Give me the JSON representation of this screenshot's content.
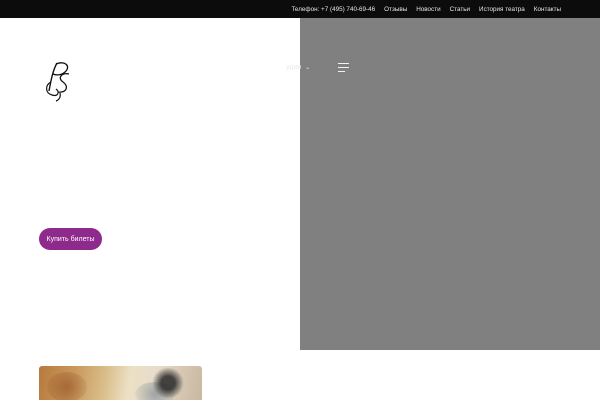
{
  "topbar": {
    "links": [
      {
        "label": "Телефон: +7 (495) 740-69-46"
      },
      {
        "label": "Отзывы"
      },
      {
        "label": "Новости"
      },
      {
        "label": "Статьи"
      },
      {
        "label": "История театра"
      },
      {
        "label": "Контакты"
      }
    ]
  },
  "nav": {
    "partial_item": "удия"
  },
  "hero": {
    "buy_button_label": "Купить билеты"
  },
  "colors": {
    "topbar_bg": "#0c0c0c",
    "hero_panel": "#808080",
    "accent": "#8e2a8b"
  },
  "icons": {
    "logo": "monogram-logo",
    "menu": "hamburger-menu-icon",
    "nav_chevron": "chevron-down-icon"
  }
}
